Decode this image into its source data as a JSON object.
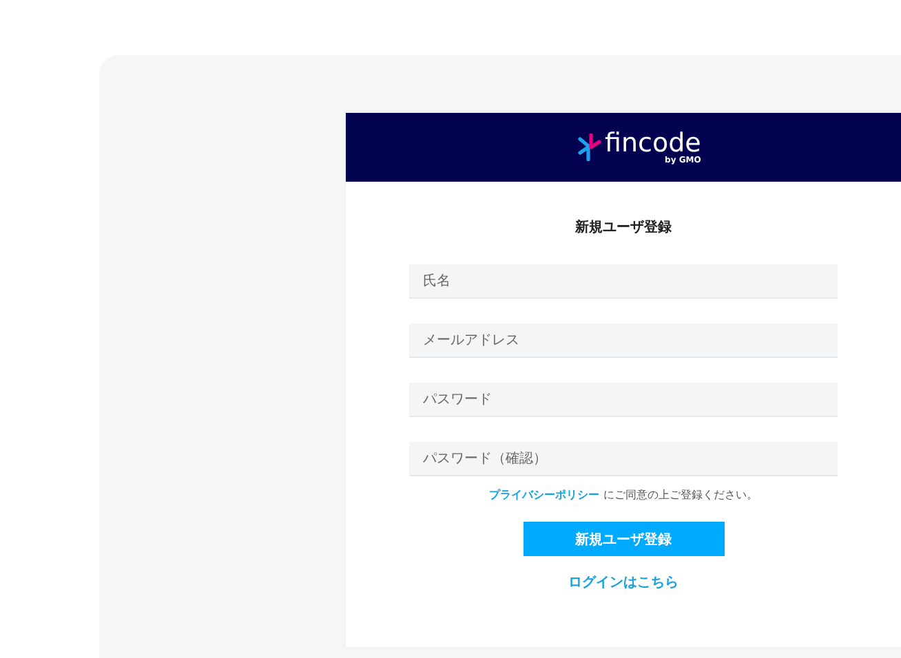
{
  "logo": {
    "name": "fincode",
    "byline": "by GMO"
  },
  "form": {
    "title": "新規ユーザ登録",
    "fields": [
      {
        "placeholder": "氏名"
      },
      {
        "placeholder": "メールアドレス"
      },
      {
        "placeholder": "パスワード"
      },
      {
        "placeholder": "パスワード（確認）"
      }
    ],
    "consent": {
      "link": "プライバシーポリシー",
      "text": "にご同意の上ご登録ください。"
    },
    "submit": "新規ユーザ登録",
    "login_link": "ログインはこちら"
  }
}
